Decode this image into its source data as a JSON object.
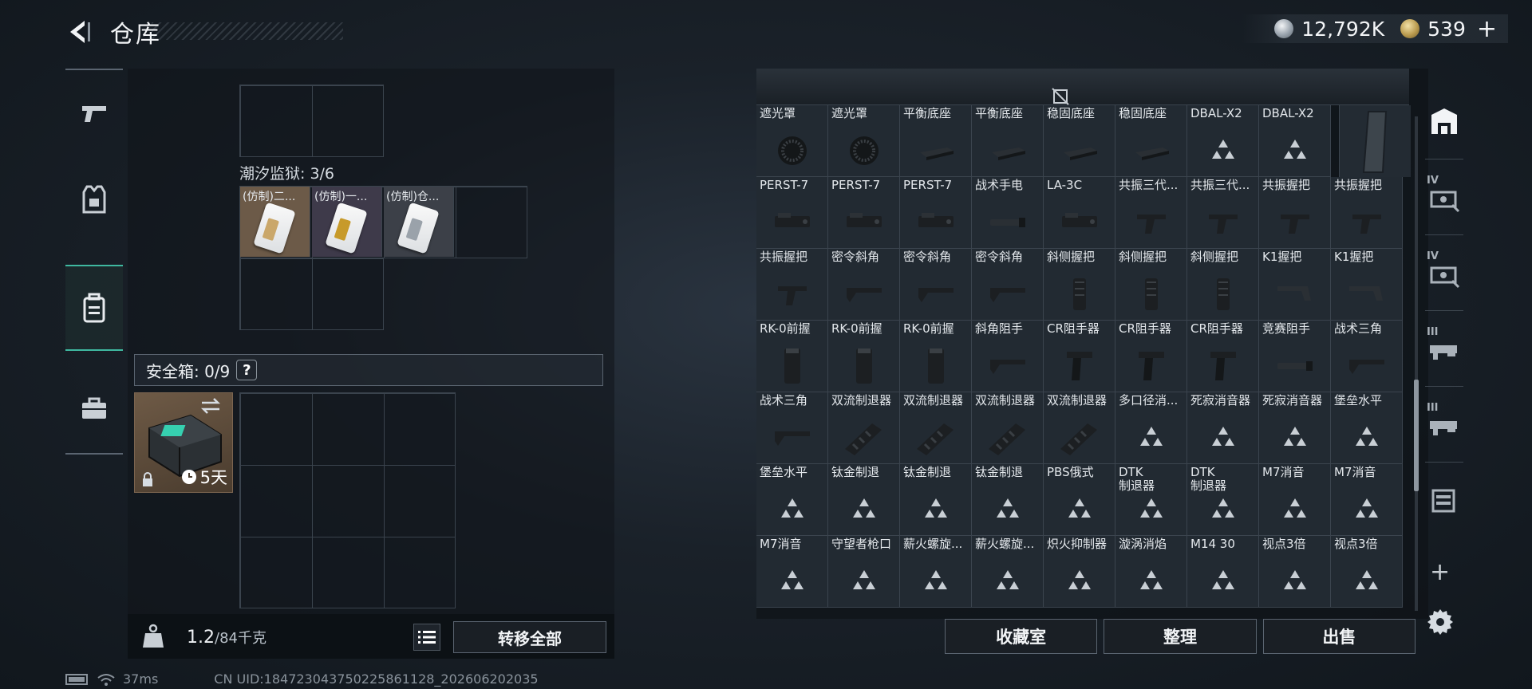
{
  "header": {
    "title": "仓库",
    "silver": "12,792K",
    "gold": "539",
    "gold_add": "+"
  },
  "left_tabs": [
    {
      "name": "gun"
    },
    {
      "name": "armor"
    },
    {
      "name": "backpack",
      "active": true
    },
    {
      "name": "case"
    }
  ],
  "tide": {
    "label": "潮汐监狱: 3/6",
    "tickets": [
      {
        "name": "(仿制)二...",
        "stripe": "#caa76a"
      },
      {
        "name": "(仿制)一...",
        "stripe": "#c79a2a"
      },
      {
        "name": "(仿制)仓...",
        "stripe": "#9aa2aa"
      }
    ]
  },
  "safe": {
    "label": "安全箱: 0/9",
    "help": "?",
    "time": "5天"
  },
  "weight": {
    "value": "1.2",
    "unit": "/84千克"
  },
  "buttons": {
    "transfer_all": "转移全部",
    "collection": "收藏室",
    "organize": "整理",
    "sell": "出售"
  },
  "status": {
    "ping": "37ms",
    "uid": "CN UID:18472304375022586112​8_202606202035"
  },
  "storage_rows": [
    [
      "遮光罩",
      "遮光罩",
      "平衡底座",
      "平衡底座",
      "稳固底座",
      "稳固底座",
      "DBAL-X2",
      "DBAL-X2"
    ],
    [
      "PERST-7",
      "PERST-7",
      "PERST-7",
      "战术手电",
      "LA-3C",
      "共振三代...",
      "共振三代...",
      "共振握把",
      "共振握把"
    ],
    [
      "共振握把",
      "密令斜角",
      "密令斜角",
      "密令斜角",
      "斜侧握把",
      "斜侧握把",
      "斜侧握把",
      "K1握把",
      "K1握把"
    ],
    [
      "RK-0前握",
      "RK-0前握",
      "RK-0前握",
      "斜角阻手",
      "CR阻手器",
      "CR阻手器",
      "CR阻手器",
      "竞赛阻手",
      "战术三角"
    ],
    [
      "战术三角",
      "双流制退器",
      "双流制退器",
      "双流制退器",
      "双流制退器",
      "多口径消...",
      "死寂消音器",
      "死寂消音器",
      "堡垒水平"
    ],
    [
      "堡垒水平",
      "钛金制退",
      "钛金制退",
      "钛金制退",
      "PBS俄式",
      "DTK\n制退器",
      "DTK\n制退器",
      "M7消音",
      "M7消音"
    ],
    [
      "M7消音",
      "守望者枪口",
      "薪火螺旋...",
      "薪火螺旋...",
      "炽火抑制器",
      "漩涡消焰",
      "M14 30",
      "视点3倍",
      "视点3倍"
    ]
  ],
  "storage_icons": [
    [
      "ring",
      "ring",
      "mount",
      "mount",
      "mount",
      "mount",
      "tri",
      "tri"
    ],
    [
      "laser",
      "laser",
      "laser",
      "flash",
      "laser",
      "grip",
      "grip",
      "grip",
      "grip"
    ],
    [
      "grip",
      "angle",
      "angle",
      "angle",
      "vgrip",
      "vgrip",
      "vgrip",
      "stock",
      "stock"
    ],
    [
      "fore",
      "fore",
      "fore",
      "angle",
      "stop",
      "stop",
      "stop",
      "flash",
      "angle"
    ],
    [
      "angle",
      "muzzle",
      "muzzle",
      "muzzle",
      "muzzle",
      "tri",
      "tri",
      "tri",
      "tri"
    ],
    [
      "tri",
      "tri",
      "tri",
      "tri",
      "tri",
      "tri",
      "tri",
      "tri",
      "tri"
    ],
    [
      "tri",
      "tri",
      "tri",
      "tri",
      "tri",
      "tri",
      "tri",
      "tri",
      "tri"
    ]
  ],
  "right_tabs": [
    {
      "name": "all-icon",
      "roman": ""
    },
    {
      "name": "scope-4-icon",
      "roman": "IV"
    },
    {
      "name": "scope-4b-icon",
      "roman": "IV"
    },
    {
      "name": "barrel-3-icon",
      "roman": "III"
    },
    {
      "name": "barrel-3b-icon",
      "roman": "III"
    },
    {
      "name": "stock-icon",
      "roman": ""
    }
  ],
  "right_plus": "+",
  "colors": {
    "accent": "#3fb8a0",
    "panel": "#222a32"
  }
}
